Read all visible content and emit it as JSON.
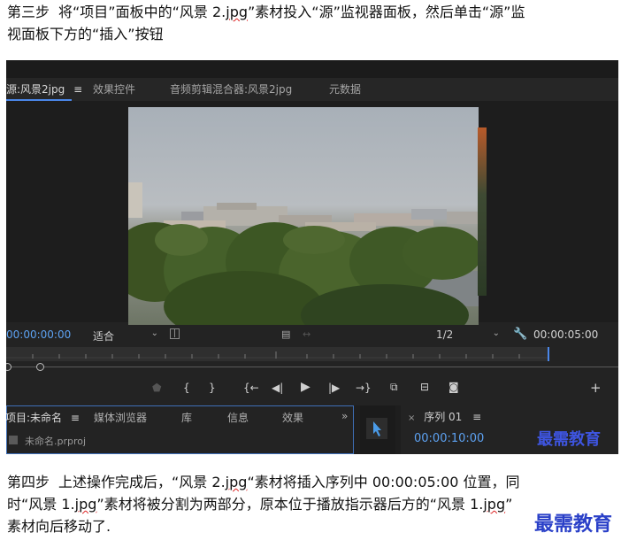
{
  "instructions": {
    "step3_label": "第三步",
    "step3_part1": "将“项目”面板中的“风景 2.",
    "step3_jpg": "jpg",
    "step3_part2": "”素材投入“源”监视器面板，然后单击“源”监",
    "step3_line2": "视面板下方的“插入”按钮",
    "step4_label": "第四步",
    "step4_part1": "上述操作完成后，“风景 2.",
    "step4_jpg": "jpg",
    "step4_part2": "“素材将插入序列中 00:00:05:00 位置，同",
    "step4_line2a": "时“风景 1.",
    "step4_line2jpg": "jpg",
    "step4_line2b": "”素材将被分割为两部分，原本位于播放指示器后方的“风景 1.",
    "step4_line2jpg2": "jpg",
    "step4_line2c": "”",
    "step4_line3": "素材向后移动了."
  },
  "source_monitor": {
    "tabs": [
      {
        "label": "源:风景2jpg",
        "menu": "≡"
      },
      {
        "label": "效果控件"
      },
      {
        "label": "音频剪辑混合器:风景2jpg"
      },
      {
        "label": "元数据"
      }
    ],
    "timecode_current": "00:00:00:00",
    "fit_label": "适合",
    "resolution": "1/2",
    "timecode_duration": "00:00:05:00"
  },
  "transport_buttons": [
    {
      "name": "add-marker-button",
      "glyph": "▼"
    },
    {
      "name": "mark-in-button",
      "glyph": "{"
    },
    {
      "name": "mark-out-button",
      "glyph": "}"
    },
    {
      "name": "go-to-in-button",
      "glyph": "{←"
    },
    {
      "name": "step-back-button",
      "glyph": "◀|"
    },
    {
      "name": "play-button",
      "glyph": "▶"
    },
    {
      "name": "step-forward-button",
      "glyph": "|▶"
    },
    {
      "name": "go-to-out-button",
      "glyph": "→}"
    },
    {
      "name": "insert-button",
      "glyph": "⊞"
    },
    {
      "name": "overwrite-button",
      "glyph": "⊟"
    },
    {
      "name": "export-frame-button",
      "glyph": "◙"
    },
    {
      "name": "button-editor-button",
      "glyph": "+"
    }
  ],
  "project_panel": {
    "tabs": [
      {
        "label": "项目:未命名",
        "menu": "≡"
      },
      {
        "label": "媒体浏览器"
      },
      {
        "label": "库"
      },
      {
        "label": "信息"
      },
      {
        "label": "效果"
      },
      {
        "label": "»"
      }
    ],
    "item": "未命名.prproj"
  },
  "sequence_panel": {
    "tab_label": "序列 01",
    "close_glyph": "×",
    "menu": "≡",
    "timecode": "00:00:10:00"
  },
  "watermark_text": "最需教育",
  "colors": {
    "accent": "#4a86e8",
    "timecode": "#5da2f2",
    "watermark": "#2a40c8"
  }
}
